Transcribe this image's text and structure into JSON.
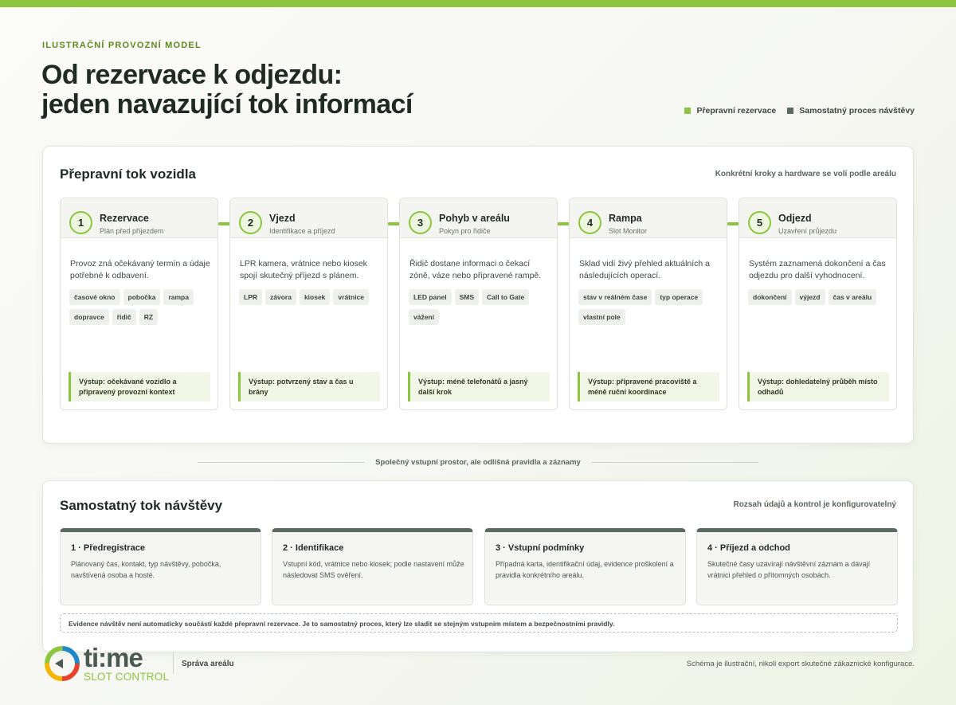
{
  "header": {
    "eyebrow": "ILUSTRAČNÍ PROVOZNÍ MODEL",
    "title_line1": "Od rezervace k odjezdu:",
    "title_line2": "jeden navazující tok informací"
  },
  "legend": {
    "items": [
      {
        "label": "Přepravní rezervace",
        "color": "#8cc63f"
      },
      {
        "label": "Samostatný proces návštěvy",
        "color": "#5d6a62"
      }
    ]
  },
  "vehicle_flow": {
    "title": "Přepravní tok vozidla",
    "note": "Konkrétní kroky a hardware se volí podle areálu",
    "steps": [
      {
        "number": "1",
        "name": "Rezervace",
        "sub": "Plán před příjezdem",
        "desc": "Provoz zná očekávaný termín a údaje potřebné k odbavení.",
        "tags": [
          "časové okno",
          "pobočka",
          "rampa",
          "dopravce",
          "řidič",
          "RZ"
        ],
        "output": "Výstup: očekávané vozidlo a připravený provozní kontext"
      },
      {
        "number": "2",
        "name": "Vjezd",
        "sub": "Identifikace a příjezd",
        "desc": "LPR kamera, vrátnice nebo kiosek spojí skutečný příjezd s plánem.",
        "tags": [
          "LPR",
          "závora",
          "kiosek",
          "vrátnice"
        ],
        "output": "Výstup: potvrzený stav a čas u brány"
      },
      {
        "number": "3",
        "name": "Pohyb v areálu",
        "sub": "Pokyn pro řidiče",
        "desc": "Řidič dostane informaci o čekací zóně, váze nebo připravené rampě.",
        "tags": [
          "LED panel",
          "SMS",
          "Call to Gate",
          "vážení"
        ],
        "output": "Výstup: méně telefonátů a jasný další krok"
      },
      {
        "number": "4",
        "name": "Rampa",
        "sub": "Slot Monitor",
        "desc": "Sklad vidí živý přehled aktuálních a následujících operací.",
        "tags": [
          "stav v reálném čase",
          "typ operace",
          "vlastní pole"
        ],
        "output": "Výstup: připravené pracoviště a méně ruční koordinace"
      },
      {
        "number": "5",
        "name": "Odjezd",
        "sub": "Uzavření průjezdu",
        "desc": "Systém zaznamená dokončení a čas odjezdu pro další vyhodnocení.",
        "tags": [
          "dokončení",
          "výjezd",
          "čas v areálu"
        ],
        "output": "Výstup: dohledatelný průběh místo odhadů"
      }
    ]
  },
  "divider_label": "Společný vstupní prostor, ale odlišná pravidla a záznamy",
  "visit_flow": {
    "title": "Samostatný tok návštěvy",
    "note": "Rozsah údajů a kontrol je konfigurovatelný",
    "cards": [
      {
        "title": "1 · Předregistrace",
        "desc": "Plánovaný čas, kontakt, typ návštěvy, pobočka, navštívená osoba a hosté."
      },
      {
        "title": "2 · Identifikace",
        "desc": "Vstupní kód, vrátnice nebo kiosek; podle nastavení může následovat SMS ověření."
      },
      {
        "title": "3 · Vstupní podmínky",
        "desc": "Případná karta, identifikační údaj, evidence proškolení a pravidla konkrétního areálu."
      },
      {
        "title": "4 · Příjezd a odchod",
        "desc": "Skutečné časy uzavírají návštěvní záznam a dávají vrátnici přehled o přítomných osobách."
      }
    ],
    "footnote": "Evidence návštěv není automaticky součástí každé přepravní rezervace. Je to samostatný proces, který lze sladit se stejným vstupním místem a bezpečnostními pravidly."
  },
  "footer": {
    "logo_text": "ti:me",
    "logo_sub": "SLOT CONTROL",
    "tagline": "Správa areálu",
    "disclaimer": "Schéma je ilustrační, nikoli export skutečné zákaznické konfigurace."
  }
}
